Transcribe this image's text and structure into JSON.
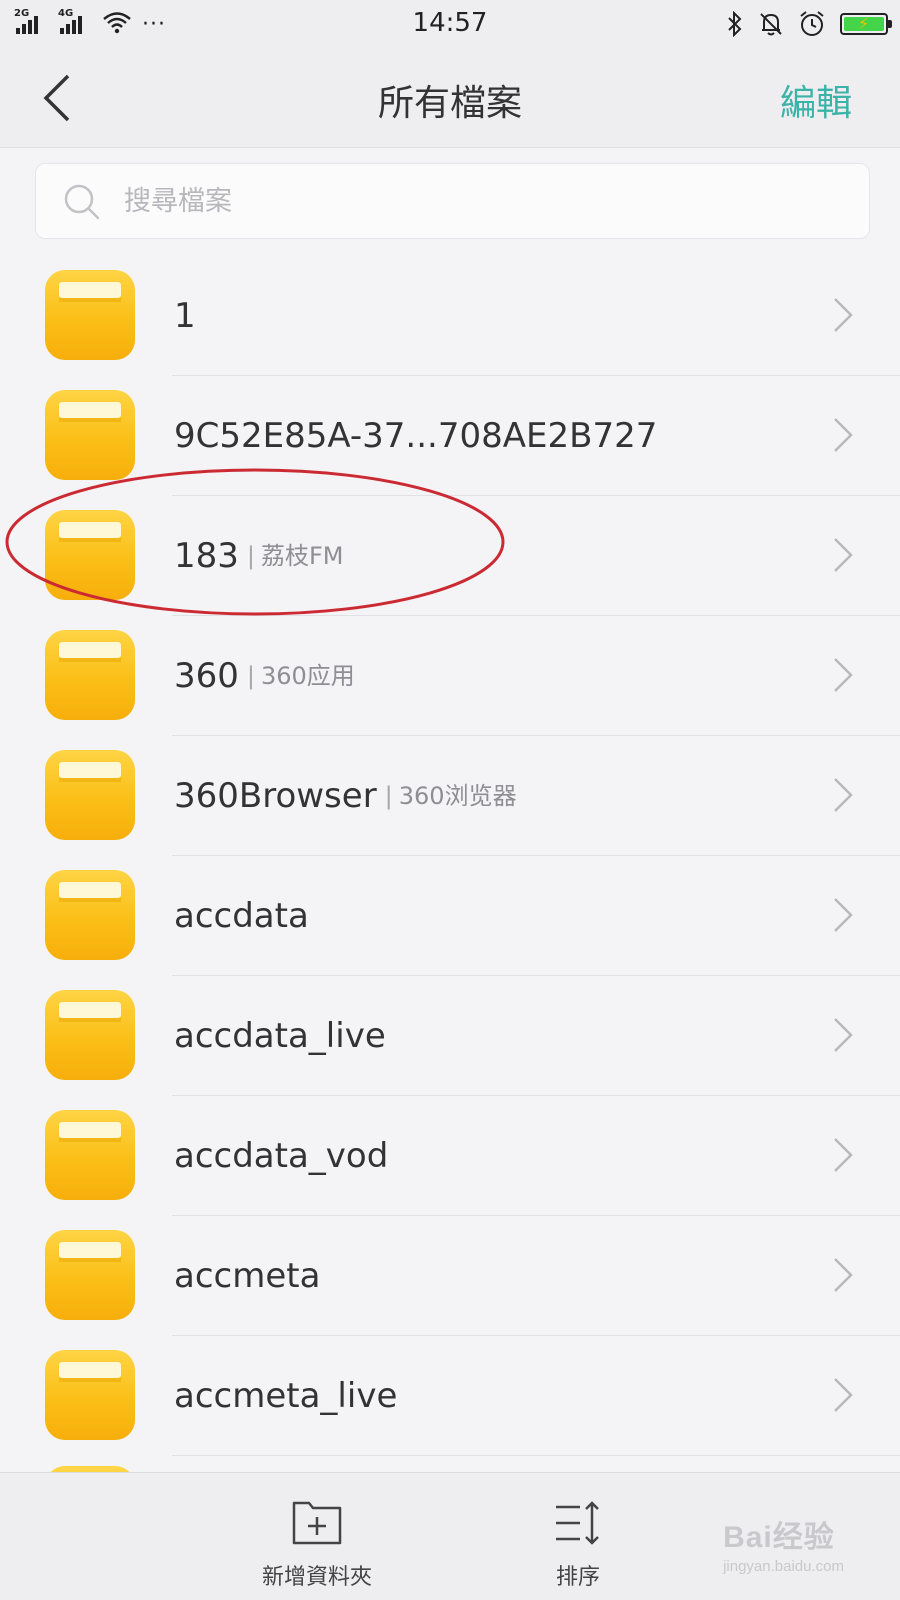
{
  "status_bar": {
    "network_1": "2G",
    "network_2": "4G",
    "more": "···",
    "time": "14:57",
    "battery_color": "#44d44a"
  },
  "header": {
    "title": "所有檔案",
    "edit_label": "編輯",
    "accent_color": "#3bb3a8"
  },
  "search": {
    "placeholder": "搜尋檔案"
  },
  "files": [
    {
      "name": "1",
      "alias": ""
    },
    {
      "name": "9C52E85A-37...708AE2B727",
      "alias": ""
    },
    {
      "name": "183",
      "alias": "荔枝FM"
    },
    {
      "name": "360",
      "alias": "360应用"
    },
    {
      "name": "360Browser",
      "alias": "360浏览器"
    },
    {
      "name": "accdata",
      "alias": ""
    },
    {
      "name": "accdata_live",
      "alias": ""
    },
    {
      "name": "accdata_vod",
      "alias": ""
    },
    {
      "name": "accmeta",
      "alias": ""
    },
    {
      "name": "accmeta_live",
      "alias": ""
    }
  ],
  "alias_separator": "|",
  "toolbar": {
    "new_folder_label": "新增資料夾",
    "sort_label": "排序"
  },
  "watermark": {
    "main": "Bai经验",
    "sub": "jingyan.baidu.com"
  }
}
